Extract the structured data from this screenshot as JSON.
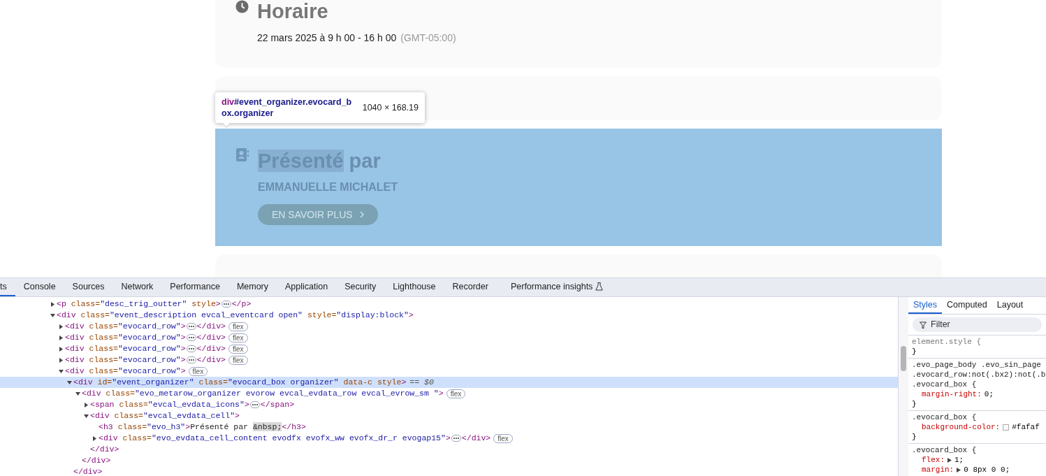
{
  "page": {
    "schedule": {
      "heading": "Horaire",
      "datetime": "22 mars 2025 à 9 h 00 - 16 h 00",
      "timezone": "(GMT-05:00)"
    },
    "organizer": {
      "highlighted": true,
      "heading_marked": "Présenté",
      "heading_rest": "par",
      "name": "EMMANUELLE MICHALET",
      "button": "EN SAVOIR PLUS"
    },
    "tooltip": {
      "tag": "div",
      "selector": "#event_organizer.evocard_box.organizer",
      "size": "1040 × 168.19"
    }
  },
  "devtools": {
    "tabs": [
      {
        "label": "ts",
        "selected": true
      },
      {
        "label": "Console",
        "selected": false
      },
      {
        "label": "Sources",
        "selected": false
      },
      {
        "label": "Network",
        "selected": false
      },
      {
        "label": "Performance",
        "selected": false
      },
      {
        "label": "Memory",
        "selected": false
      },
      {
        "label": "Application",
        "selected": false
      },
      {
        "label": "Security",
        "selected": false
      },
      {
        "label": "Lighthouse",
        "selected": false
      },
      {
        "label": "Recorder",
        "selected": false
      },
      {
        "label": "Performance insights",
        "selected": false,
        "kind": "experiment"
      }
    ],
    "dom_tree": [
      {
        "open": "<p class=\"desc_trig_outter\" style>",
        "close": "</p>",
        "expanded": false,
        "selected": false
      },
      {
        "open": "<div class=\"event_description evcal_eventcard open\" style=\"display:block\">",
        "expanded": true,
        "selected": false,
        "children": [
          {
            "open": "<div class=\"evocard_row\">",
            "close": "</div>",
            "badge": "flex",
            "expanded": false,
            "selected": false
          },
          {
            "open": "<div class=\"evocard_row\">",
            "close": "</div>",
            "badge": "flex",
            "expanded": false,
            "selected": false
          },
          {
            "open": "<div class=\"evocard_row\">",
            "close": "</div>",
            "badge": "flex",
            "expanded": false,
            "selected": false
          },
          {
            "open": "<div class=\"evocard_row\">",
            "close": "</div>",
            "badge": "flex",
            "expanded": false,
            "selected": false
          },
          {
            "open": "<div class=\"evocard_row\">",
            "badge": "flex",
            "expanded": true,
            "selected": false,
            "children": [
              {
                "open": "<div id=\"event_organizer\" class=\"evocard_box organizer\" data-c style>",
                "suffix": "== $0",
                "close": "</div>",
                "expanded": true,
                "selected": true,
                "children": [
                  {
                    "open": "<div class=\"evo_metarow_organizer evorow evcal_evdata_row evcal_evrow_sm \">",
                    "badge": "flex",
                    "close": "</div>",
                    "expanded": true,
                    "selected": false,
                    "children": [
                      {
                        "open": "<span class=\"evcal_evdata_icons\">",
                        "close": "</span>",
                        "expanded": false,
                        "selected": false
                      },
                      {
                        "open": "<div class=\"evcal_evdata_cell\">",
                        "close": "</div>",
                        "expanded": true,
                        "selected": false,
                        "children": [
                          {
                            "open": "<h3 class=\"evo_h3\">",
                            "content": "Présenté par ",
                            "entity": "&nbsp;",
                            "close": "</h3>",
                            "selected": false
                          },
                          {
                            "open": "<div class=\"evo_evdata_cell_content evodfx evofx_ww evofx_dr_r evogap15\">",
                            "close": "</div>",
                            "badge": "flex",
                            "expanded": false,
                            "selected": false
                          }
                        ]
                      }
                    ]
                  }
                ]
              }
            ]
          }
        ]
      }
    ],
    "styles_tabs": [
      {
        "label": "Styles",
        "selected": true
      },
      {
        "label": "Computed",
        "selected": false
      },
      {
        "label": "Layout",
        "selected": false
      }
    ],
    "filter": {
      "placeholder": "Filter"
    },
    "rules": [
      {
        "selector": [
          "element.style {"
        ],
        "close": "}"
      },
      {
        "selector": [
          ".evo_page_body .evo_sin_page",
          ".evocard_row:not(.bx2):not(.b",
          ".evocard_box {"
        ],
        "declarations": [
          {
            "property": "margin-right:",
            "value": "0;"
          }
        ],
        "close": "}"
      },
      {
        "selector": [
          ".evocard_box {"
        ],
        "declarations": [
          {
            "property": "background-color:",
            "value": "#fafaf",
            "color": "#fafafa"
          }
        ],
        "close": "}"
      },
      {
        "selector": [
          ".evocard_box {"
        ],
        "declarations": [
          {
            "property": "flex:",
            "value": "1;",
            "expandable": true
          },
          {
            "property": "margin:",
            "value": "0 8px 0 0;",
            "expandable": true
          }
        ]
      }
    ]
  }
}
